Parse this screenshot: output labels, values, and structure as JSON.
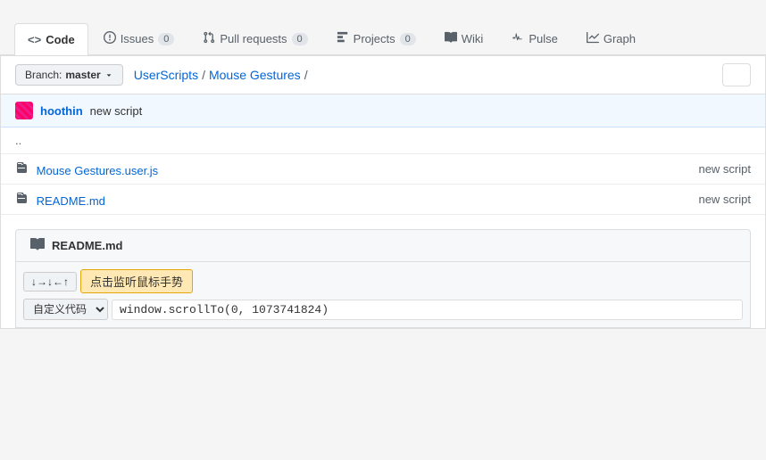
{
  "nav": {
    "tabs": [
      {
        "id": "code",
        "icon": "<>",
        "label": "Code",
        "badge": null,
        "active": true
      },
      {
        "id": "issues",
        "icon": "!",
        "label": "Issues",
        "badge": "0",
        "active": false
      },
      {
        "id": "pull-requests",
        "icon": "⑂",
        "label": "Pull requests",
        "badge": "0",
        "active": false
      },
      {
        "id": "projects",
        "icon": "☰",
        "label": "Projects",
        "badge": "0",
        "active": false
      },
      {
        "id": "wiki",
        "icon": "≡",
        "label": "Wiki",
        "badge": null,
        "active": false
      },
      {
        "id": "pulse",
        "icon": "~",
        "label": "Pulse",
        "badge": null,
        "active": false
      },
      {
        "id": "graphs",
        "icon": "▦",
        "label": "Graph",
        "badge": null,
        "active": false
      }
    ]
  },
  "breadcrumb": {
    "branch_prefix": "Branch:",
    "branch_name": "master",
    "path_parts": [
      "UserScripts",
      "Mouse Gestures"
    ],
    "trailing_slash": "/"
  },
  "commit": {
    "username": "hoothin",
    "message": "new script"
  },
  "files": [
    {
      "name": "..",
      "type": "dotdot",
      "commit_msg": null
    },
    {
      "name": "Mouse Gestures.user.js",
      "type": "file",
      "commit_msg": "new script"
    },
    {
      "name": "README.md",
      "type": "file",
      "commit_msg": "new script"
    }
  ],
  "readme": {
    "label": "README.md"
  },
  "console": {
    "toolbar_arrows": "↓→↓←↑",
    "highlight_text": "点击监听鼠标手势",
    "select_label": "自定义代码 ▾",
    "input_value": "window.scrollTo(0, 1073741824)"
  }
}
